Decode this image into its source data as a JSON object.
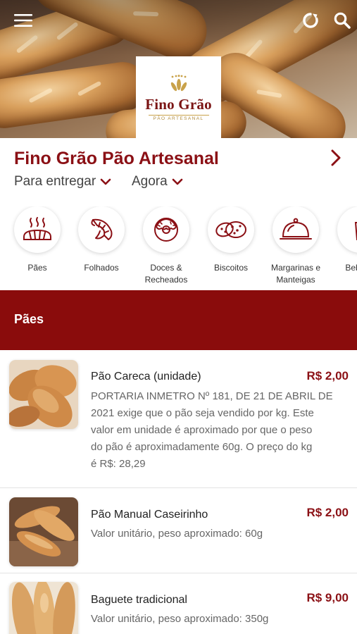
{
  "hero": {
    "logo": {
      "title": "Fino Grão",
      "subtitle": "PÃO ARTESANAL"
    },
    "menu_icon": "hamburger-menu-icon",
    "refresh_icon": "refresh-icon",
    "search_icon": "search-icon"
  },
  "store": {
    "name": "Fino Grão Pão Artesanal",
    "delivery_mode": "Para entregar",
    "delivery_time": "Agora"
  },
  "categories": [
    {
      "label": "Pães",
      "icon": "bread-icon"
    },
    {
      "label": "Folhados",
      "icon": "croissant-icon"
    },
    {
      "label": "Doces &\nRecheados",
      "icon": "donut-icon"
    },
    {
      "label": "Biscoitos",
      "icon": "cookies-icon"
    },
    {
      "label": "Margarinas e\nManteigas",
      "icon": "cloche-icon"
    },
    {
      "label": "Bebidas",
      "icon": "drink-icon"
    }
  ],
  "section": {
    "title": "Pães"
  },
  "products": [
    {
      "name": "Pão Careca (unidade)",
      "price": "R$ 2,00",
      "desc_lines": [
        "PORTARIA INMETRO Nº 181, DE 21 DE ABRIL DE",
        "2021 exige que o pão seja vendido por kg. Este",
        "valor em unidade é aproximado por que o peso",
        "do pão é aproximadamente 60g. O preço do kg",
        "é R$: 28,29"
      ]
    },
    {
      "name": "Pão Manual Caseirinho",
      "price": "R$ 2,00",
      "desc_lines": [
        "Valor unitário, peso aproximado: 60g"
      ]
    },
    {
      "name": "Baguete tradicional",
      "price": "R$ 9,00",
      "desc_lines": [
        "Valor unitário, peso aproximado: 350g"
      ]
    }
  ],
  "colors": {
    "brand": "#8b1015",
    "banner": "#8a0c0c",
    "gold": "#c9a24a"
  }
}
